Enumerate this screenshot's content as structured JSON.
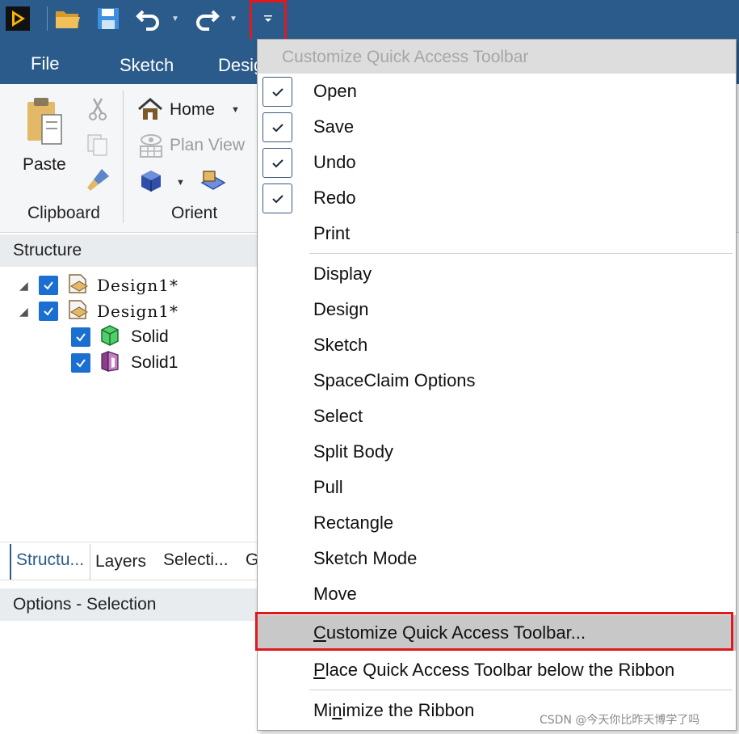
{
  "qat": {
    "icons": [
      "app-logo-icon",
      "open-folder-icon",
      "save-disk-icon",
      "undo-arrow-icon",
      "redo-arrow-icon",
      "customize-dropdown-icon"
    ]
  },
  "ribbon_tabs": [
    "File",
    "Sketch",
    "Desig"
  ],
  "clipboard": {
    "paste_label": "Paste",
    "group_label": "Clipboard"
  },
  "orient": {
    "home_label": "Home",
    "plan_view_label": "Plan View",
    "group_label": "Orient"
  },
  "structure": {
    "title": "Structure",
    "tree": [
      {
        "label": "Design1*"
      },
      {
        "label": "Design1*"
      },
      {
        "label": "Solid"
      },
      {
        "label": "Solid1"
      }
    ]
  },
  "bottom_tabs": [
    "Structu...",
    "Layers",
    "Selecti...",
    "G"
  ],
  "options": {
    "title": "Options - Selection"
  },
  "menu": {
    "header": "Customize Quick Access Toolbar",
    "checked_items": [
      "Open",
      "Save",
      "Undo",
      "Redo"
    ],
    "print_label": "Print",
    "items": [
      "Display",
      "Design",
      "Sketch",
      "SpaceClaim Options",
      "Select",
      "Split Body",
      "Pull",
      "Rectangle",
      "Sketch Mode",
      "Move"
    ],
    "customize": {
      "first": "C",
      "rest": "ustomize Quick Access Toolbar..."
    },
    "place_below": {
      "first": "P",
      "rest": "lace Quick Access Toolbar below the Ribbon"
    },
    "minimize": {
      "pre": "Mi",
      "u": "n",
      "rest": "imize the Ribbon"
    }
  },
  "colors": {
    "title_bar": "#2b5b8a",
    "highlight": "#e0191f",
    "check_blue": "#1a6fd0"
  },
  "watermark": "CSDN @今天你比昨天博学了吗"
}
